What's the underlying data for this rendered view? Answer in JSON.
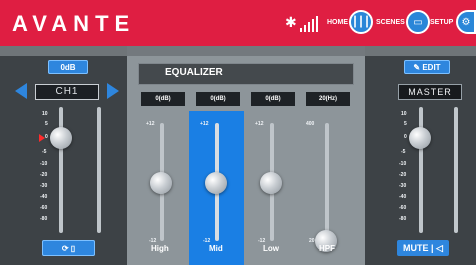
{
  "header": {
    "brand": "AVANTE",
    "nav": {
      "home": "HOME",
      "scenes": "SCENES",
      "setup": "SETUP"
    }
  },
  "left_panel": {
    "gain": "0dB",
    "channel": "CH1",
    "scale": [
      "10",
      "5",
      "0",
      "-5",
      "-10",
      "-20",
      "-30",
      "-40",
      "-60",
      "-80"
    ]
  },
  "center_panel": {
    "title": "EQUALIZER",
    "values": [
      "0(dB)",
      "0(dB)",
      "0(dB)",
      "20(Hz)"
    ],
    "bands": [
      {
        "label": "High",
        "top": "+12",
        "bottom": "-12"
      },
      {
        "label": "Mid",
        "top": "+12",
        "bottom": "-12"
      },
      {
        "label": "Low",
        "top": "+12",
        "bottom": "-12"
      },
      {
        "label": "HPF",
        "top": "400",
        "bottom": "20"
      }
    ]
  },
  "right_panel": {
    "edit": "EDIT",
    "title": "MASTER",
    "scale": [
      "10",
      "5",
      "0",
      "-5",
      "-10",
      "-20",
      "-30",
      "-40",
      "-60",
      "-80"
    ],
    "mute": "MUTE"
  }
}
